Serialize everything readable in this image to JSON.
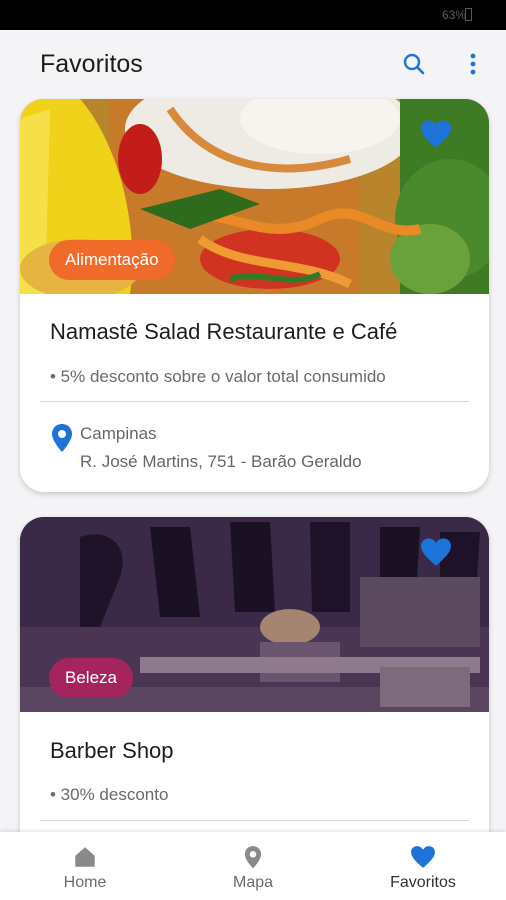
{
  "status_bar": {
    "battery": "63%"
  },
  "app_bar": {
    "title": "Favoritos",
    "search_icon": "search-icon",
    "menu_icon": "more-vert-icon"
  },
  "colors": {
    "accent": "#1e73d8",
    "food_category": "#f06a2a",
    "beauty_category": "#a6245e"
  },
  "cards": [
    {
      "category": "Alimentação",
      "title": "Namastê Salad Restaurante e Café",
      "benefit": "• 5% desconto sobre o valor total consumido",
      "city": "Campinas",
      "address": "R. José Martins, 751 - Barão Geraldo"
    },
    {
      "category": "Beleza",
      "title": "Barber Shop",
      "benefit": "• 30% desconto"
    }
  ],
  "bottom_nav": {
    "items": [
      {
        "label": "Home",
        "icon": "home-icon"
      },
      {
        "label": "Mapa",
        "icon": "map-pin-icon"
      },
      {
        "label": "Favoritos",
        "icon": "heart-icon"
      }
    ],
    "active": "Favoritos"
  }
}
